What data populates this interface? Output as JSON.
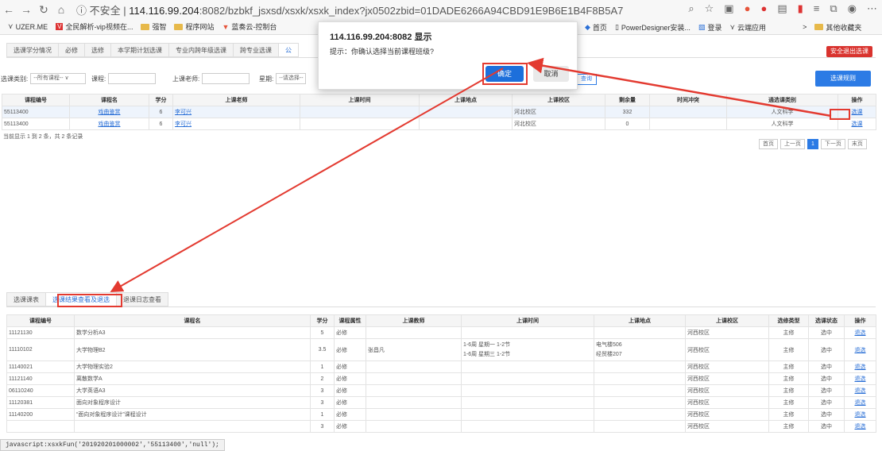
{
  "browser": {
    "url_prefix": "不安全",
    "url_host": "114.116.99.204",
    "url_rest": ":8082/bzbkf_jsxsd/xsxk/xsxk_index?jx0502zbid=01DADE6266A94CBD91E9B6E1B4F8B5A7",
    "bookmarks": [
      "UZER.ME",
      "全民解析-vip视频在...",
      "强智",
      "程序网站",
      "蓝奏云-控制台"
    ],
    "bookmarks_right": [
      "首页",
      "PowerDesigner安装...",
      "登录",
      "云端应用"
    ],
    "bookmark_other": "其他收藏夹"
  },
  "top_tabs": [
    "选课学分情况",
    "必修",
    "选修",
    "本学期计划选课",
    "专业内跨年级选课",
    "跨专业选课",
    "公"
  ],
  "exit_button": "安全退出选课",
  "filters": {
    "type_label": "选课类别:",
    "type_value": "--所有课程--",
    "course_label": "课程:",
    "teacher_label": "上课老师:",
    "week_label": "星期:",
    "week_value": "--请选择--",
    "query_btn": "查询",
    "rules_btn": "选课规则"
  },
  "top_table": {
    "headers": [
      "课程编号",
      "课程名",
      "学分",
      "上课老师",
      "上课时间",
      "上课地点",
      "上课校区",
      "剩余量",
      "时间冲突",
      "通选课类别",
      "操作"
    ],
    "rows": [
      [
        "55113400",
        "戏曲鉴赏",
        "6",
        "李可兴",
        "",
        "",
        "河北校区",
        "332",
        "",
        "人文科学",
        "选课"
      ],
      [
        "55113400",
        "戏曲鉴赏",
        "6",
        "李可兴",
        "",
        "",
        "河北校区",
        "0",
        "",
        "人文科学",
        "选课"
      ]
    ],
    "summary": "当前显示 1 到 2 条，共 2 条记录"
  },
  "pager": [
    "首页",
    "上一页",
    "1",
    "下一页",
    "末页"
  ],
  "dialog": {
    "title": "114.116.99.204:8082 显示",
    "message": "提示：你确认选择当前课程班级?",
    "ok": "确定",
    "cancel": "取消"
  },
  "bottom_tabs": [
    "选课课表",
    "选课结果查看及退选",
    "退课日志查看"
  ],
  "bottom_table": {
    "headers": [
      "课程编号",
      "课程名",
      "学分",
      "课程属性",
      "上课教师",
      "上课时间",
      "上课地点",
      "上课校区",
      "选修类型",
      "选课状态",
      "操作"
    ],
    "rows": [
      [
        "11121130",
        "数学分析A3",
        "5",
        "必修",
        "",
        "",
        "",
        "河西校区",
        "主修",
        "选中",
        "退选"
      ],
      [
        "11110102",
        "大学物理B2",
        "3.5",
        "必修",
        "张昌凡",
        "1-6周 星期一 1-2节\n1-6周 星期三 1-2节",
        "电气楼506\n经贸楼207",
        "河西校区",
        "主修",
        "选中",
        "退选"
      ],
      [
        "11140021",
        "大学物理实验2",
        "1",
        "必修",
        "",
        "",
        "",
        "河西校区",
        "主修",
        "选中",
        "退选"
      ],
      [
        "11121140",
        "离散数学A",
        "2",
        "必修",
        "",
        "",
        "",
        "河西校区",
        "主修",
        "选中",
        "退选"
      ],
      [
        "06110240",
        "大学英语A3",
        "3",
        "必修",
        "",
        "",
        "",
        "河西校区",
        "主修",
        "选中",
        "退选"
      ],
      [
        "11120381",
        "面向对象程序设计",
        "3",
        "必修",
        "",
        "",
        "",
        "河西校区",
        "主修",
        "选中",
        "退选"
      ],
      [
        "11140200",
        "“面向对象程序设计”课程设计",
        "1",
        "必修",
        "",
        "",
        "",
        "河西校区",
        "主修",
        "选中",
        "退选"
      ],
      [
        "",
        "",
        "3",
        "必修",
        "",
        "",
        "",
        "河西校区",
        "主修",
        "选中",
        "退选"
      ]
    ]
  },
  "status_bar": "javascript:xsxkFun('201920201000002','55113400','null');"
}
